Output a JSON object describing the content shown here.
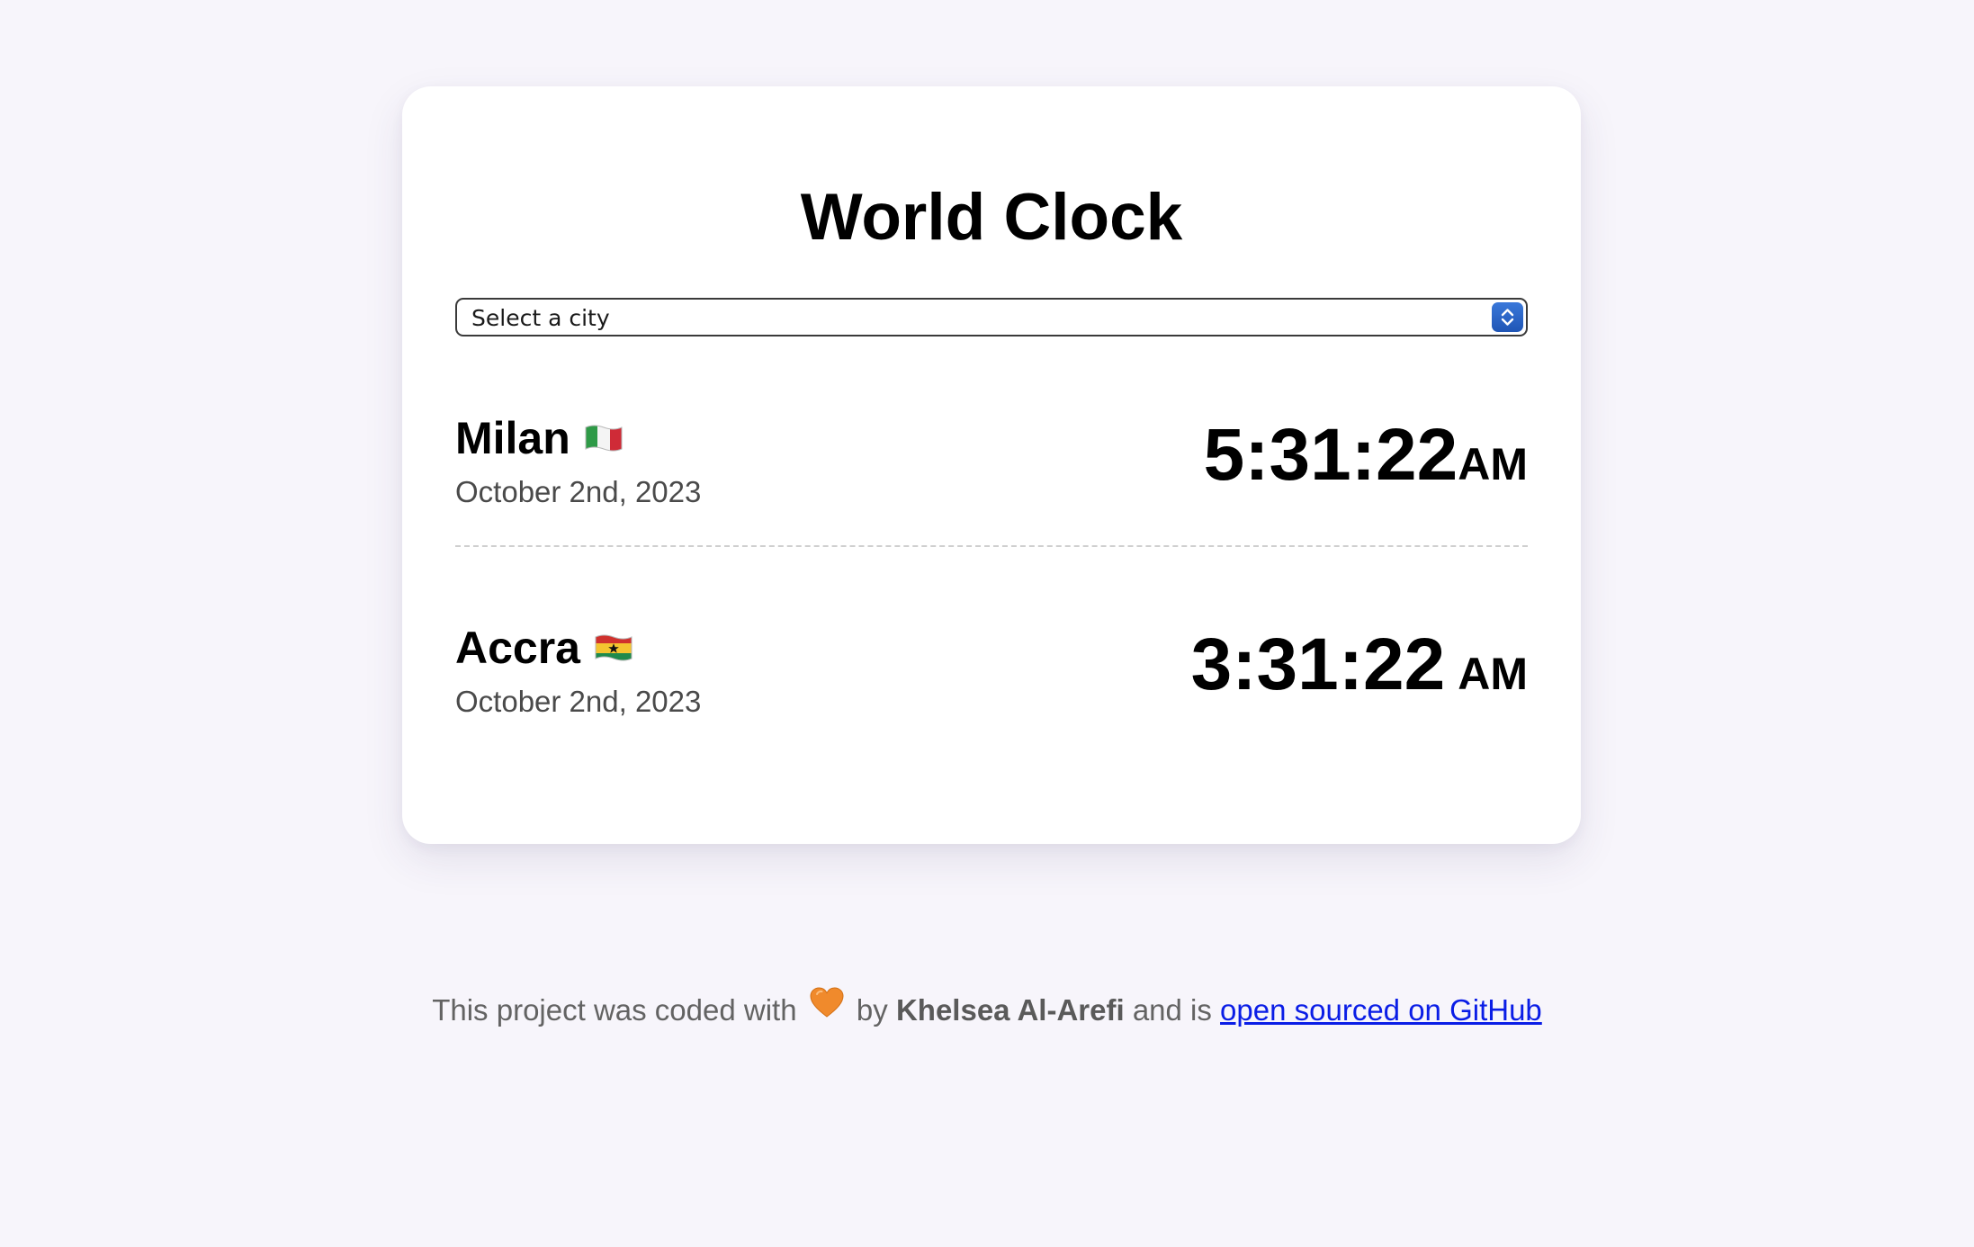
{
  "app": {
    "title": "World Clock"
  },
  "city_select": {
    "placeholder": "Select a city",
    "icon": "select-updown-arrows-icon",
    "accent_color": "#2c63c4"
  },
  "cities": [
    {
      "name": "Milan",
      "flag_icon": "italy-flag-icon",
      "date": "October 2nd, 2023",
      "time": "5:31:22",
      "ampm": "AM"
    },
    {
      "name": "Accra",
      "flag_icon": "ghana-flag-icon",
      "date": "October 2nd, 2023",
      "time": "3:31:22",
      "ampm": "AM"
    }
  ],
  "footer": {
    "prefix": "This project was coded with",
    "heart_icon": "orange-heart-icon",
    "by": "by",
    "author": "Khelsea Al-Arefi",
    "middle": "and is",
    "link_text": "open sourced on GitHub",
    "link_color": "#0a1de6"
  },
  "colors": {
    "background": "#f7f5fb",
    "card": "#ffffff",
    "text": "#000000",
    "muted_text": "#4a4a4a"
  }
}
